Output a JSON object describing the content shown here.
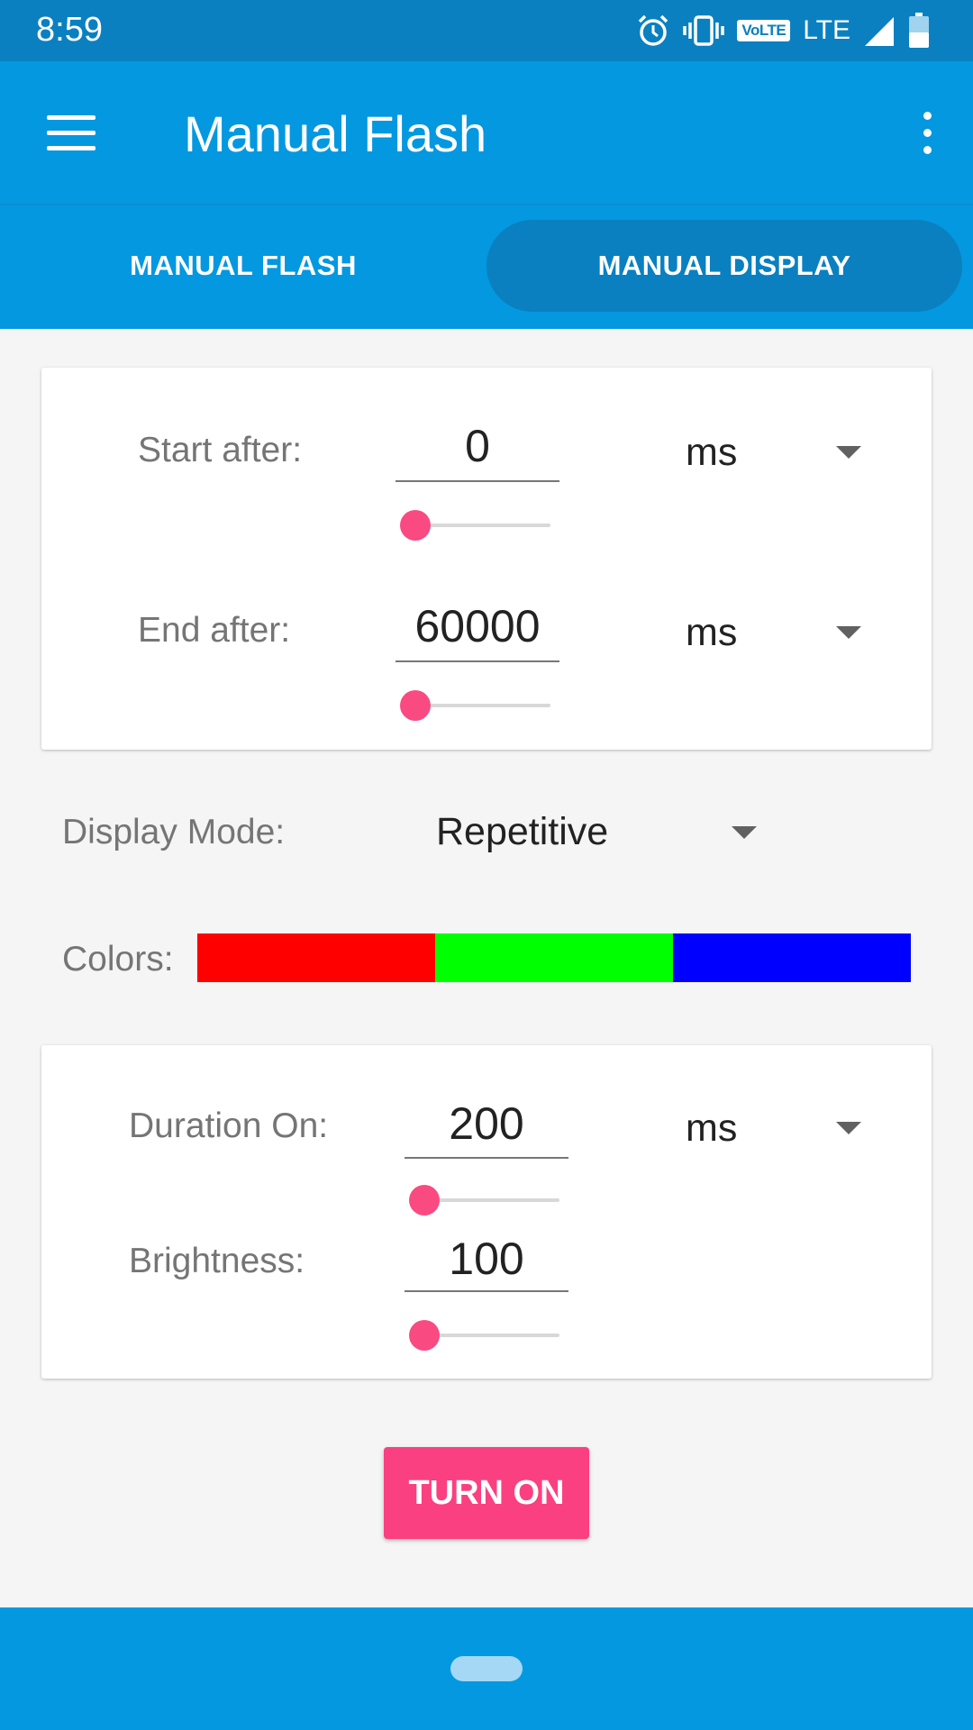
{
  "status_bar": {
    "time": "8:59",
    "network": "LTE",
    "volte": "VoLTE"
  },
  "app_bar": {
    "title": "Manual Flash"
  },
  "tabs": [
    {
      "label": "MANUAL FLASH",
      "selected": false
    },
    {
      "label": "MANUAL DISPLAY",
      "selected": true
    }
  ],
  "timing": {
    "start_label": "Start after:",
    "start_value": "0",
    "start_unit": "ms",
    "end_label": "End after:",
    "end_value": "60000",
    "end_unit": "ms"
  },
  "display_mode": {
    "label": "Display Mode:",
    "value": "Repetitive"
  },
  "colors": {
    "label": "Colors:",
    "swatches": [
      "#ff0000",
      "#00ff00",
      "#0000ff"
    ]
  },
  "settings": {
    "duration_label": "Duration On:",
    "duration_value": "200",
    "duration_unit": "ms",
    "brightness_label": "Brightness:",
    "brightness_value": "100"
  },
  "action": {
    "turn_on_label": "TURN ON"
  },
  "theme": {
    "primary": "#0398e0",
    "primary_dark": "#0a80c0",
    "accent": "#fa4080"
  }
}
